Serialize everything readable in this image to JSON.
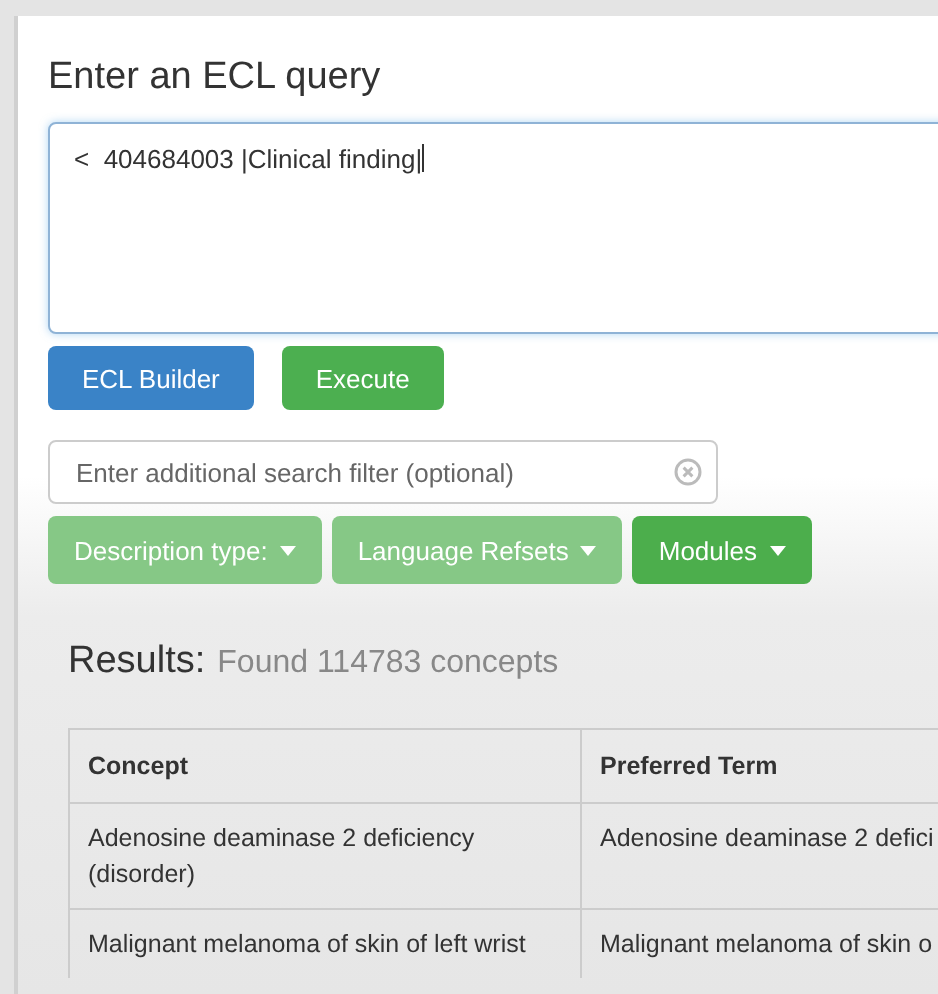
{
  "title": "Enter an ECL query",
  "query": {
    "value": "<  404684003 |Clinical finding|"
  },
  "buttons": [
    {
      "label": "ECL Builder",
      "kind": "primary"
    },
    {
      "label": "Execute",
      "kind": "success"
    }
  ],
  "filter": {
    "placeholder": "Enter additional search filter (optional)"
  },
  "dropdowns": [
    {
      "label": "Description type:",
      "disabled": true
    },
    {
      "label": "Language Refsets",
      "disabled": true
    },
    {
      "label": "Modules",
      "disabled": false
    }
  ],
  "results": {
    "label": "Results:",
    "summary": "Found 114783 concepts"
  },
  "table": {
    "columns": [
      "Concept",
      "Preferred Term"
    ],
    "rows": [
      [
        "Adenosine deaminase 2 deficiency (disorder)",
        "Adenosine deaminase 2 defici"
      ],
      [
        "Malignant melanoma of skin of left wrist",
        "Malignant melanoma of skin o"
      ]
    ]
  }
}
